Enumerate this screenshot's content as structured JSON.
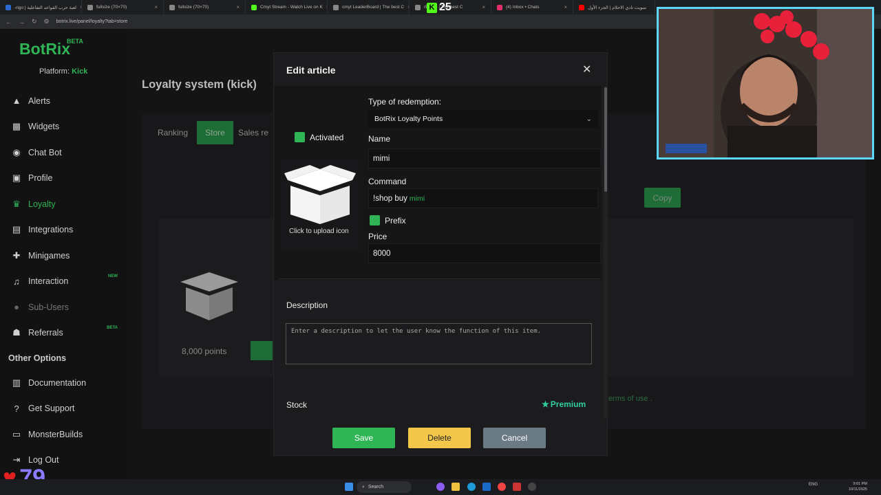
{
  "browser": {
    "tabs": [
      {
        "title": "-rigo | لعبة حرب القواعد التفاعلية",
        "color": "#2a6bd1"
      },
      {
        "title": "fullsize (70×70)",
        "color": "#888"
      },
      {
        "title": "fullsize (70×70)",
        "color": "#888"
      },
      {
        "title": "Cmyt Stream - Watch Live on K",
        "color": "#53fc18"
      },
      {
        "title": "cmyt LeaderBoard | The best C",
        "color": "#888"
      },
      {
        "title": "rBoard | The best C",
        "color": "#888"
      },
      {
        "title": "(4) Inbox • Chats",
        "color": "#e1306c"
      },
      {
        "title": "سويت نادي الاحلام | الجزء الأول",
        "color": "#ff0000"
      }
    ],
    "url": "botrix.live/panel/loyalty?tab=store"
  },
  "overlay": {
    "kick_count": "25",
    "heart_count": "79"
  },
  "sidebar": {
    "logo": "BotRix",
    "beta": "BETA",
    "platform_label": "Platform:",
    "platform_value": "Kick",
    "items": [
      {
        "label": "Alerts",
        "icon": "warning-icon"
      },
      {
        "label": "Widgets",
        "icon": "grid-icon"
      },
      {
        "label": "Chat Bot",
        "icon": "robot-icon"
      },
      {
        "label": "Profile",
        "icon": "user-icon"
      },
      {
        "label": "Loyalty",
        "icon": "trophy-icon"
      },
      {
        "label": "Integrations",
        "icon": "server-icon"
      },
      {
        "label": "Minigames",
        "icon": "gamepad-icon"
      },
      {
        "label": "Interaction",
        "icon": "music-icon",
        "tag": "NEW"
      },
      {
        "label": "Sub-Users",
        "icon": "users-icon"
      },
      {
        "label": "Referrals",
        "icon": "people-icon",
        "tag": "BETA"
      }
    ],
    "other_title": "Other Options",
    "other_items": [
      {
        "label": "Documentation",
        "icon": "book-icon"
      },
      {
        "label": "Get Support",
        "icon": "question-icon"
      },
      {
        "label": "MonsterBuilds",
        "icon": "monitor-icon"
      },
      {
        "label": "Log Out",
        "icon": "logout-icon"
      }
    ]
  },
  "background": {
    "page_title": "Loyalty system (kick)",
    "tabs": [
      "Ranking",
      "Store",
      "Sales re"
    ],
    "copy_label": "Copy",
    "points": "8,000 points",
    "terms": "erms of use ."
  },
  "modal": {
    "title": "Edit article",
    "type_label": "Type of redemption:",
    "type_value": "BotRix Loyalty Points",
    "activated_label": "Activated",
    "upload_label": "Click to upload icon",
    "name_label": "Name",
    "name_value": "mimi",
    "command_label": "Command",
    "command_prefix": "!shop buy",
    "command_name": "mimi",
    "prefix_label": "Prefix",
    "price_label": "Price",
    "price_value": "8000",
    "description_label": "Description",
    "description_placeholder": "Enter a description to let the user know the function of this item.",
    "stock_label": "Stock",
    "premium_label": "Premium",
    "save_label": "Save",
    "delete_label": "Delete",
    "cancel_label": "Cancel"
  },
  "taskbar": {
    "search_label": "Search",
    "lang": "ENG",
    "time": "9:01 PM",
    "date": "10/11/2025"
  }
}
